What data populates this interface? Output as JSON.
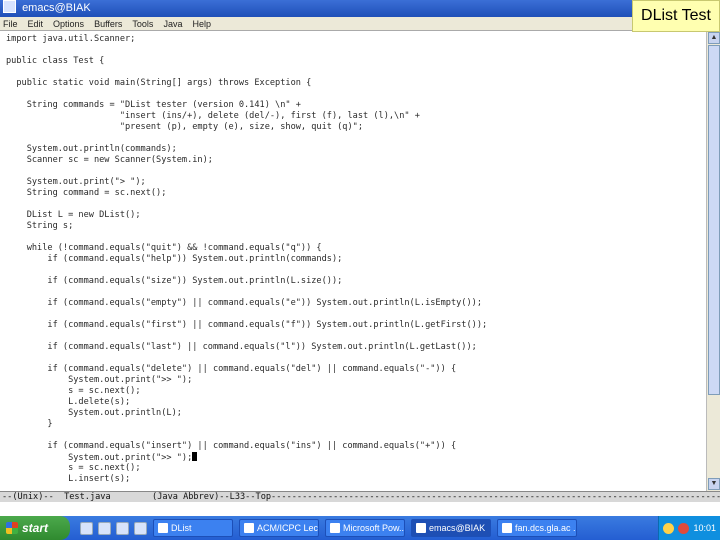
{
  "window": {
    "title": "emacs@BIAK"
  },
  "slide_title": "DList Test",
  "menu": [
    "File",
    "Edit",
    "Options",
    "Buffers",
    "Tools",
    "Java",
    "Help"
  ],
  "code_lines": [
    "import java.util.Scanner;",
    "",
    "public class Test {",
    "",
    "  public static void main(String[] args) throws Exception {",
    "",
    "    String commands = \"DList tester (version 0.141) \\n\" +",
    "                      \"insert (ins/+), delete (del/-), first (f), last (l),\\n\" +",
    "                      \"present (p), empty (e), size, show, quit (q)\";",
    "",
    "    System.out.println(commands);",
    "    Scanner sc = new Scanner(System.in);",
    "",
    "    System.out.print(\"> \");",
    "    String command = sc.next();",
    "",
    "    DList L = new DList();",
    "    String s;",
    "",
    "    while (!command.equals(\"quit\") && !command.equals(\"q\")) {",
    "        if (command.equals(\"help\")) System.out.println(commands);",
    "",
    "        if (command.equals(\"size\")) System.out.println(L.size());",
    "",
    "        if (command.equals(\"empty\") || command.equals(\"e\")) System.out.println(L.isEmpty());",
    "",
    "        if (command.equals(\"first\") || command.equals(\"f\")) System.out.println(L.getFirst());",
    "",
    "        if (command.equals(\"last\") || command.equals(\"l\")) System.out.println(L.getLast());",
    "",
    "        if (command.equals(\"delete\") || command.equals(\"del\") || command.equals(\"-\")) {",
    "            System.out.print(\">> \");",
    "            s = sc.next();",
    "            L.delete(s);",
    "            System.out.println(L);",
    "        }",
    "",
    "        if (command.equals(\"insert\") || command.equals(\"ins\") || command.equals(\"+\")) {",
    "            System.out.print(\">> \");",
    "            s = sc.next();",
    "            L.insert(s);"
  ],
  "modeline": "--(Unix)--  Test.java        (Java Abbrev)--L33--Top-----------------------------------------------------------------------------------------",
  "taskbar": {
    "start_label": "start",
    "tasks": [
      {
        "label": "DList",
        "active": false
      },
      {
        "label": "ACM/ICPC Lecture ...",
        "active": false
      },
      {
        "label": "Microsoft Pow...",
        "active": false
      },
      {
        "label": "emacs@BIAK",
        "active": true
      },
      {
        "label": "fan.dcs.gla.ac ...",
        "active": false
      }
    ],
    "clock": "10:01"
  }
}
